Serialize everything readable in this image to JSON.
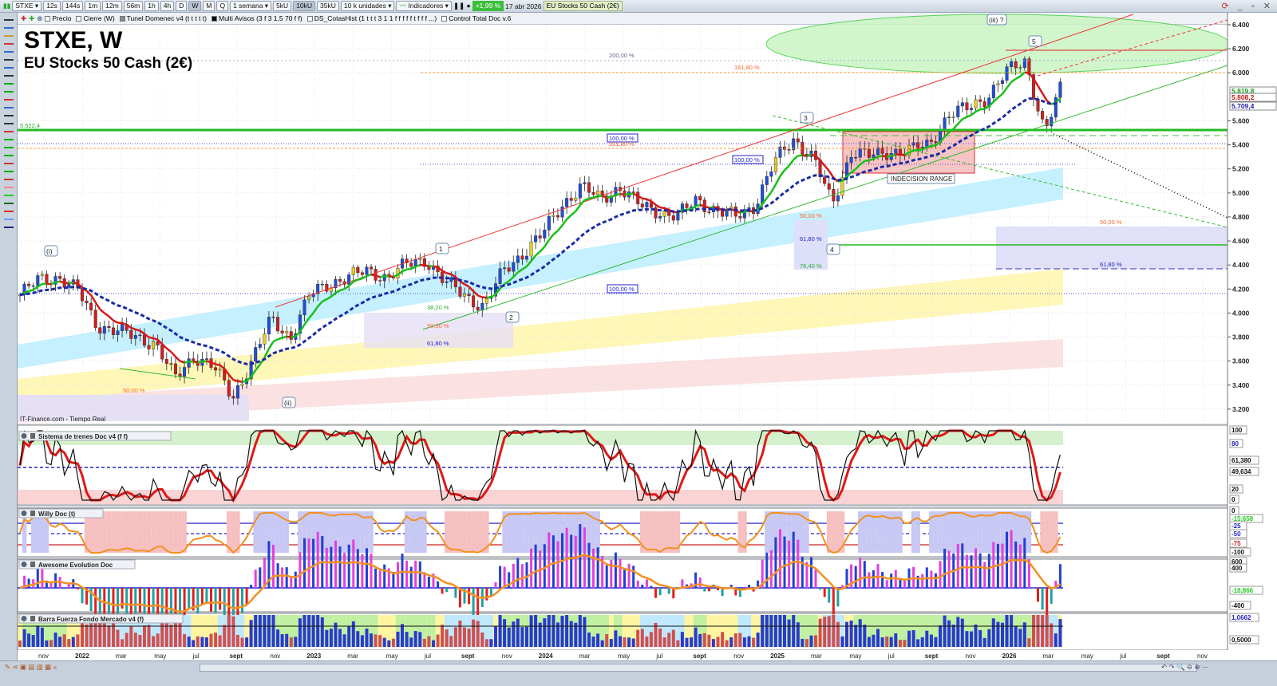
{
  "toolbar": {
    "symbol": "STXE",
    "intervals": [
      "12s",
      "144s",
      "1m",
      "12m",
      "56m",
      "1h",
      "4h",
      "D",
      "W",
      "M",
      "Q"
    ],
    "active_interval": "W",
    "period": "1 semana",
    "units": [
      "5kU",
      "10kU",
      "35kU"
    ],
    "active_unit": "10kU",
    "units_select": "10 k unidades",
    "indicators_label": "Indicadores",
    "change": "+1,99 %",
    "date": "17 abr 2026",
    "instrument": "EU Stocks 50 Cash (2€)"
  },
  "indicator_bar": [
    "Precio",
    "Cierre (W)",
    "Tunel Domenec v4 (t t t t t)",
    "Multi Avisos (3 f 3 1,5 70 f f)",
    "DS_CotasHist (1 t t t 3 1 1 f f f f f t f f f ...)",
    "Control Total Doc v.6"
  ],
  "chart": {
    "title": "STXE, W",
    "subtitle": "EU Stocks 50 Cash (2€)",
    "source": "IT-Finance.com - Tiempo Real",
    "level_label": "5.522,4",
    "indecision": "INDECISION RANGE",
    "waves": [
      {
        "t": "(i)"
      },
      {
        "t": "(ii)"
      },
      {
        "t": "1"
      },
      {
        "t": "2"
      },
      {
        "t": "3"
      },
      {
        "t": "4"
      },
      {
        "t": "5"
      },
      {
        "t": "(iii) ?"
      }
    ],
    "fibs": [
      "200,00 %",
      "161,80 %",
      "100,00 %",
      "161,80 %",
      "100,00 %",
      "100,00 %",
      "50,00 %",
      "61,80 %",
      "76,40 %",
      "38,20 %",
      "50,00 %",
      "61,80 %",
      "50,00 %",
      "61,80 %",
      "50,00 %"
    ],
    "price_tags": [
      {
        "v": "5.819,8",
        "c": "#1a9a1a"
      },
      {
        "v": "5.808,2",
        "c": "#c01818"
      },
      {
        "v": "5.709,4",
        "c": "#2222aa"
      }
    ]
  },
  "price_axis": [
    "6.400",
    "6.200",
    "6.000",
    "5.600",
    "5.400",
    "5.200",
    "5.000",
    "4.800",
    "4.600",
    "4.400",
    "4.200",
    "4.000",
    "3.800",
    "3.600",
    "3.400",
    "3.200"
  ],
  "panels": [
    {
      "title": "Sistema de trenes Doc v4 (f f)",
      "axis": [
        "100",
        "80",
        "61,380",
        "49,634",
        "20",
        "0"
      ]
    },
    {
      "title": "Willy Doc (t)",
      "axis": [
        "0",
        "-15,658",
        "-25",
        "-50",
        "-75",
        "-100"
      ]
    },
    {
      "title": "Awesome Evolution Doc",
      "axis": [
        "600",
        "400",
        "-18,866",
        "-400"
      ]
    },
    {
      "title": "Barra Fuerza Fondo Mercado v4 (f)",
      "axis": [
        "1,0662",
        "0,5000"
      ]
    }
  ],
  "time_axis": [
    "nov",
    "2022",
    "mar",
    "may",
    "jul",
    "sept",
    "nov",
    "2023",
    "mar",
    "may",
    "jul",
    "sept",
    "nov",
    "2024",
    "mar",
    "may",
    "jul",
    "sept",
    "nov",
    "2025",
    "mar",
    "may",
    "jul",
    "sept",
    "nov",
    "2026",
    "mar",
    "may",
    "jul",
    "sept",
    "nov"
  ],
  "chart_data": {
    "type": "candlestick",
    "timeframe": "weekly",
    "start": "2021-10",
    "ylim": [
      3200,
      6400
    ],
    "monthly_close": [
      4150,
      4280,
      4300,
      4180,
      3900,
      3850,
      3800,
      3750,
      3450,
      3650,
      3550,
      3300,
      3600,
      3950,
      3800,
      4150,
      4250,
      4300,
      4350,
      4300,
      4400,
      4450,
      4250,
      4150,
      4050,
      4350,
      4500,
      4650,
      4900,
      5050,
      4950,
      5050,
      4900,
      4850,
      4800,
      4950,
      4850,
      4800,
      4900,
      5250,
      5450,
      5300,
      4900,
      5350,
      5300,
      5350,
      5350,
      5400,
      5650,
      5700,
      5800,
      6000,
      6100,
      5500,
      5950
    ]
  }
}
